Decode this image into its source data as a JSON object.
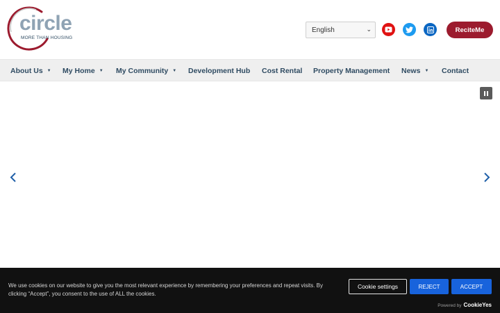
{
  "header": {
    "logo": {
      "word": "circle",
      "tagline": "MORE THAN HOUSING"
    },
    "language": {
      "selected": "English"
    },
    "social": [
      {
        "name": "youtube-icon",
        "color": "#e01212"
      },
      {
        "name": "twitter-icon",
        "color": "#1d9bf0"
      },
      {
        "name": "linkedin-icon",
        "color": "#0a66c2"
      }
    ],
    "recite_label": "ReciteMe"
  },
  "nav": {
    "items": [
      {
        "label": "About Us",
        "dropdown": true
      },
      {
        "label": "My Home",
        "dropdown": true
      },
      {
        "label": "My Community",
        "dropdown": true
      },
      {
        "label": "Development Hub",
        "dropdown": false
      },
      {
        "label": "Cost Rental",
        "dropdown": false
      },
      {
        "label": "Property Management",
        "dropdown": false
      },
      {
        "label": "News",
        "dropdown": true
      },
      {
        "label": "Contact",
        "dropdown": false
      }
    ]
  },
  "cookie": {
    "text": "We use cookies on our website to give you the most relevant experience by remembering your preferences and repeat visits. By clicking “Accept”, you consent to the use of ALL the cookies.",
    "settings_label": "Cookie settings",
    "reject_label": "REJECT",
    "accept_label": "ACCEPT",
    "powered_by": "Powered by",
    "powered_brand": "CookieYes"
  },
  "colors": {
    "brand_red": "#9c1b2e",
    "nav_text": "#2f4b62",
    "cookie_button": "#1863dc"
  }
}
